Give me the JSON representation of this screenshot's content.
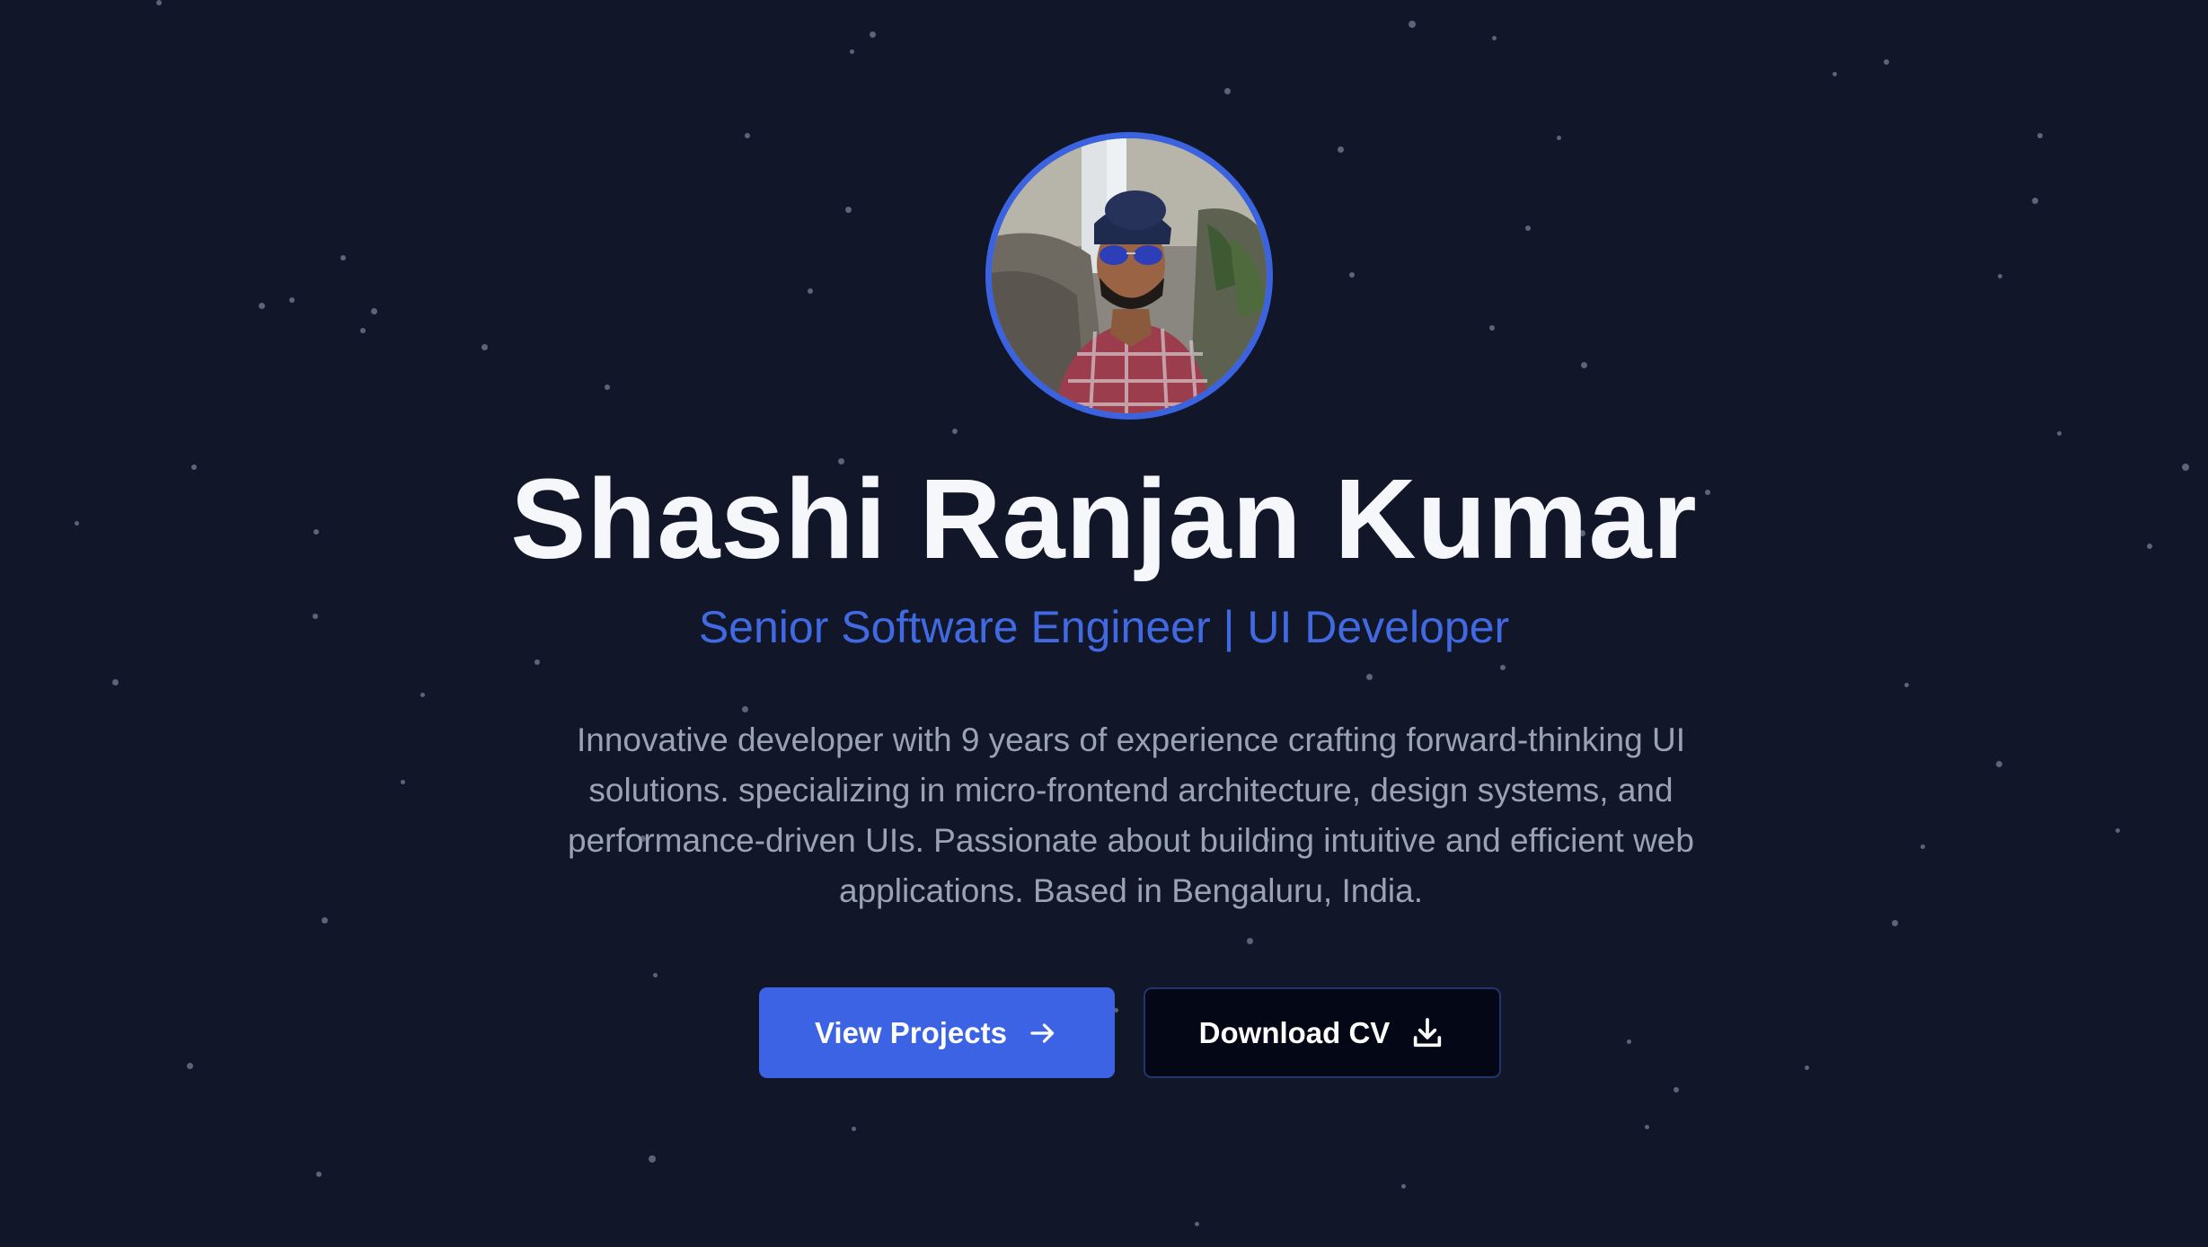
{
  "profile": {
    "name": "Shashi Ranjan Kumar",
    "subtitle": "Senior Software Engineer | UI Developer",
    "bio": "Innovative developer with 9 years of experience crafting forward-thinking UI solutions. specializing in micro-frontend architecture, design systems, and performance-driven UIs. Passionate about building intuitive and efficient web applications. Based in Bengaluru, India.",
    "avatar_alt": "Profile photo of Shashi Ranjan Kumar"
  },
  "actions": {
    "view_projects": {
      "label": "View Projects",
      "icon": "arrow-right-icon"
    },
    "download_cv": {
      "label": "Download CV",
      "icon": "download-icon"
    }
  },
  "colors": {
    "background": "#111729",
    "accent": "#3b63e3",
    "name_text": "#f5f7fb",
    "bio_text": "#9aa3b4"
  }
}
